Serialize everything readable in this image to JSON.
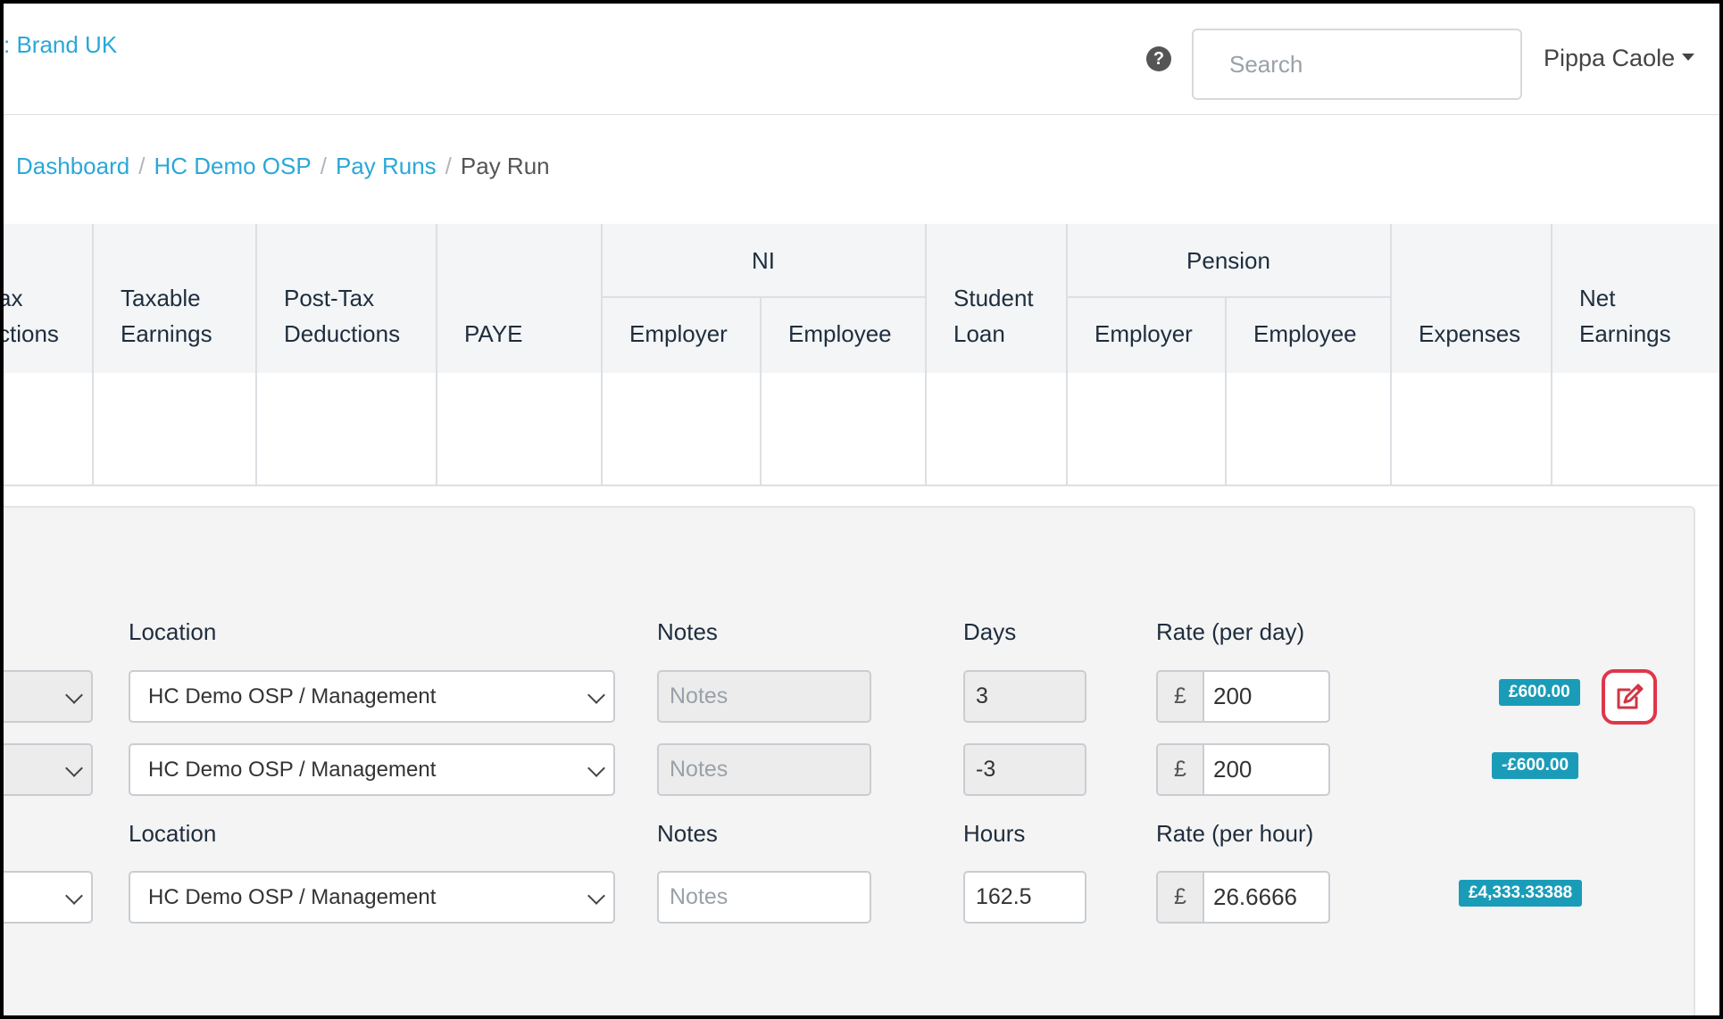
{
  "header": {
    "brand": ": Brand UK",
    "search_placeholder": "Search",
    "user_name": "Pippa Caole",
    "help_glyph": "?"
  },
  "breadcrumb": {
    "items": [
      "Dashboard",
      "HC Demo OSP",
      "Pay Runs"
    ],
    "current": "Pay Run",
    "separator": "/"
  },
  "table": {
    "columns": {
      "tax_deductions": [
        "ax",
        "ctions"
      ],
      "taxable_earnings": [
        "Taxable",
        "Earnings"
      ],
      "post_tax_deductions": [
        "Post-Tax",
        "Deductions"
      ],
      "paye": "PAYE",
      "ni": {
        "group": "NI",
        "employer": "Employer",
        "employee": "Employee"
      },
      "student_loan": [
        "Student",
        "Loan"
      ],
      "pension": {
        "group": "Pension",
        "employer": "Employer",
        "employee": "Employee"
      },
      "expenses": "Expenses",
      "net_earnings": [
        "Net",
        "Earnings"
      ]
    }
  },
  "form": {
    "section1": {
      "labels": {
        "location": "Location",
        "notes": "Notes",
        "quantity": "Days",
        "rate": "Rate (per day)"
      },
      "rows": [
        {
          "location": "HC Demo OSP / Management",
          "notes_placeholder": "Notes",
          "quantity": "3",
          "currency": "£",
          "rate": "200",
          "total": "£600.00"
        },
        {
          "location": "HC Demo OSP / Management",
          "notes_placeholder": "Notes",
          "quantity": "-3",
          "currency": "£",
          "rate": "200",
          "total": "-£600.00"
        }
      ]
    },
    "section2": {
      "labels": {
        "location": "Location",
        "notes": "Notes",
        "quantity": "Hours",
        "rate": "Rate (per hour)"
      },
      "rows": [
        {
          "location": "HC Demo OSP / Management",
          "notes_placeholder": "Notes",
          "quantity": "162.5",
          "currency": "£",
          "rate": "26.6666",
          "total": "£4,333.33388"
        }
      ]
    }
  },
  "icons": {
    "help": "help-icon",
    "edit": "edit-icon",
    "caret": "caret-down-icon",
    "chevron": "chevron-down-icon"
  },
  "colors": {
    "link": "#2aa8d8",
    "badge": "#1a9cb8",
    "edit_highlight": "#e0364a",
    "header_bg": "#f3f5f7"
  }
}
